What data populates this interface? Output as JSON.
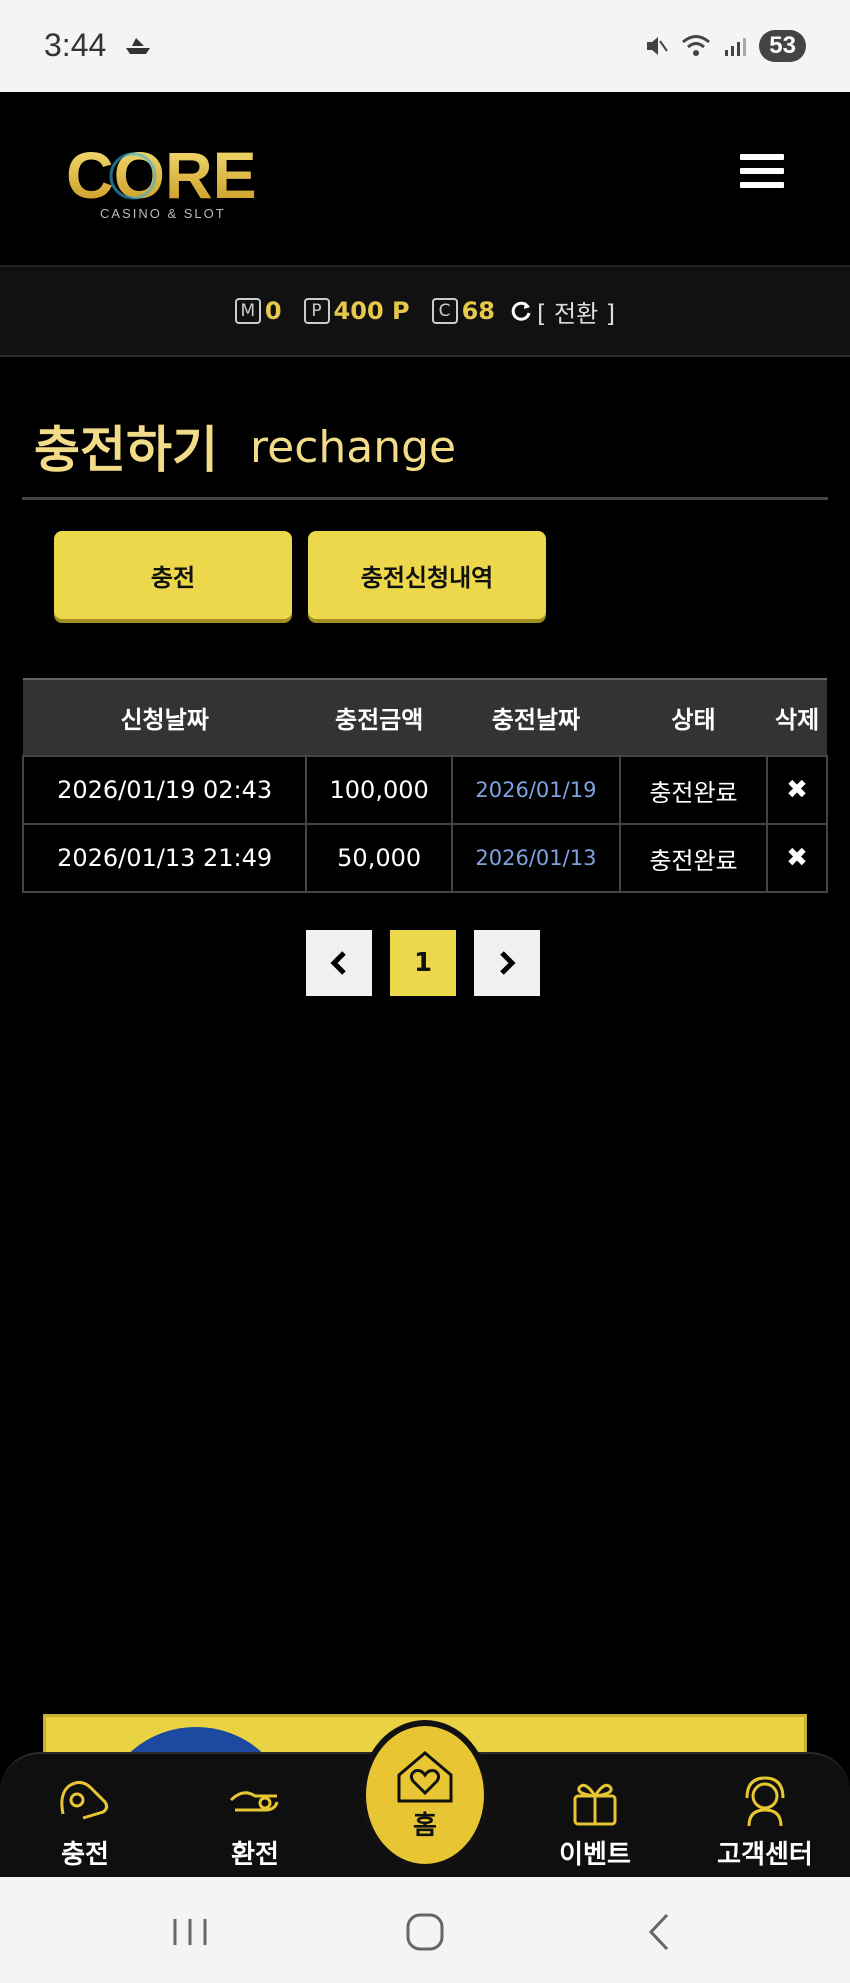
{
  "status_bar": {
    "time": "3:44",
    "battery": "53"
  },
  "header": {
    "logo_text": "CORE",
    "logo_sub": "CASINO & SLOT",
    "menu_icon": "hamburger-icon"
  },
  "balance": {
    "m_icon": "M",
    "m_value": "0",
    "p_icon": "P",
    "p_value": "400 P",
    "c_icon": "C",
    "c_value": "68",
    "switch_label": "[ 전환 ]"
  },
  "page": {
    "title_kr": "충전하기",
    "title_en": "rechange"
  },
  "tabs": {
    "charge": "충전",
    "history": "충전신청내역"
  },
  "table": {
    "headers": [
      "신청날짜",
      "충전금액",
      "충전날짜",
      "상태",
      "삭제"
    ],
    "rows": [
      {
        "request_date": "2026/01/19 02:43",
        "amount": "100,000",
        "charge_date": "2026/01/19",
        "status": "충전완료"
      },
      {
        "request_date": "2026/01/13 21:49",
        "amount": "50,000",
        "charge_date": "2026/01/13",
        "status": "충전완료"
      }
    ]
  },
  "pager": {
    "current": "1"
  },
  "bottom_nav": {
    "charge": "충전",
    "exchange": "환전",
    "home": "홈",
    "event": "이벤트",
    "support": "고객센터"
  },
  "colors": {
    "accent": "#ecd84a",
    "title": "#f2dc88",
    "link": "#7fa3e0"
  }
}
